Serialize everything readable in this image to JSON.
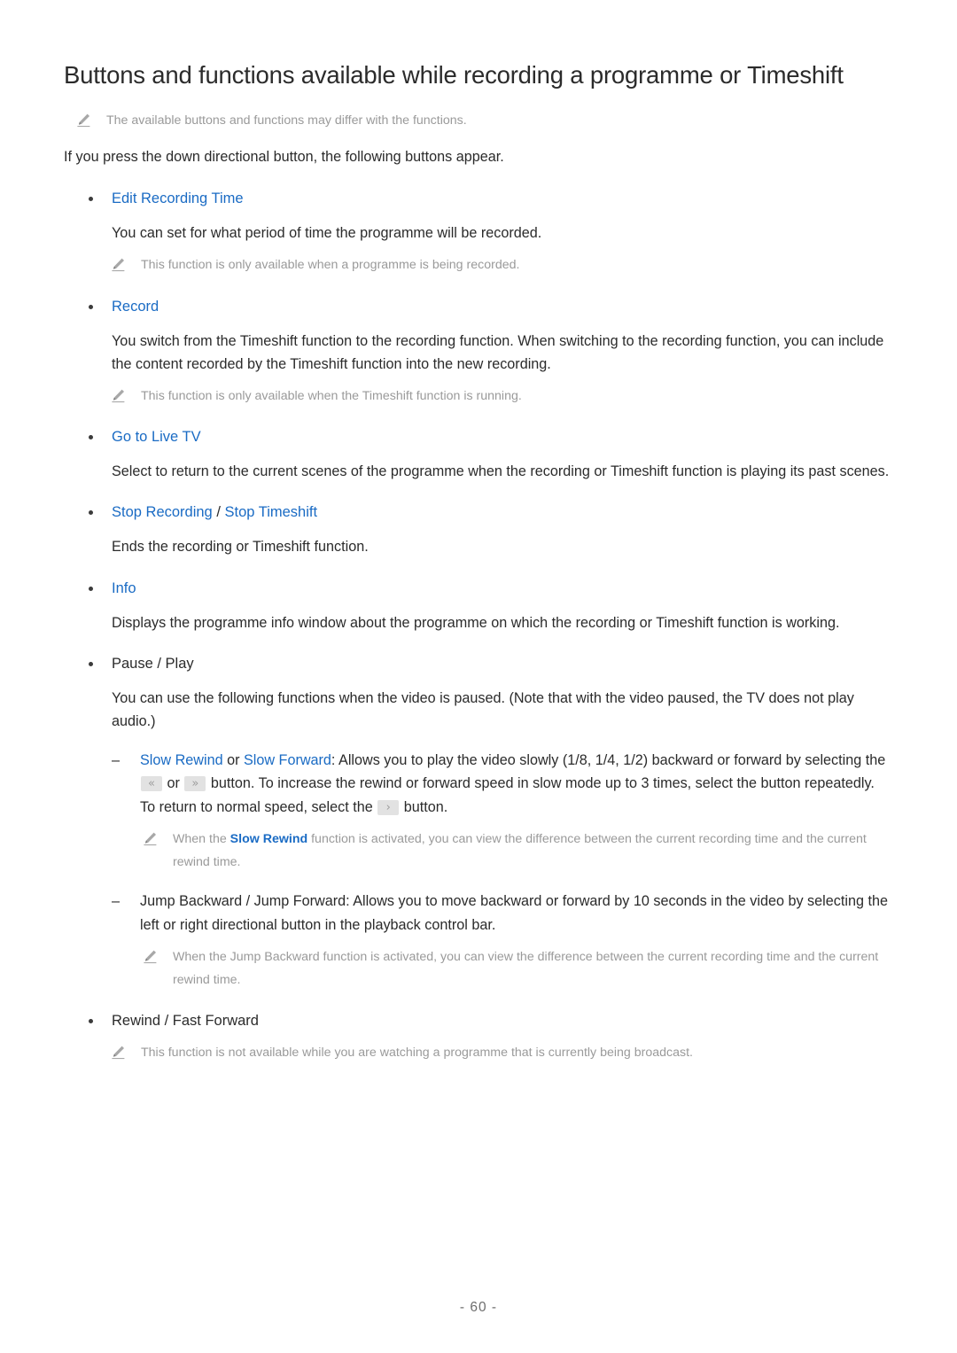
{
  "document": {
    "title": "Buttons and functions available while recording a programme or Timeshift",
    "page_number": "- 60 -",
    "accent_color": "#1a6bc4",
    "note_color": "#9a9a9a",
    "body_color": "#2b2b2b"
  },
  "top_note": {
    "icon": "pencil-icon",
    "text": "The available buttons and functions may differ with the functions."
  },
  "intro": "If you press the down directional button, the following buttons appear.",
  "sections": [
    {
      "heading": {
        "parts": [
          {
            "text": "Edit Recording Time",
            "style": "blue"
          }
        ]
      },
      "body": "You can set for what period of time the programme will be recorded.",
      "note": "This function is only available when a programme is being recorded."
    },
    {
      "heading": {
        "parts": [
          {
            "text": "Record",
            "style": "blue"
          }
        ]
      },
      "body": "You switch from the Timeshift function to the recording function. When switching to the recording function, you can include the content recorded by the Timeshift function into the new recording.",
      "note": "This function is only available when the Timeshift function is running."
    },
    {
      "heading": {
        "parts": [
          {
            "text": "Go to Live TV",
            "style": "blue"
          }
        ]
      },
      "body": "Select to return to the current scenes of the programme when the recording or Timeshift function is playing its past scenes.",
      "note": null
    },
    {
      "heading": {
        "parts": [
          {
            "text": "Stop Recording",
            "style": "blue"
          },
          {
            "text": " / ",
            "style": "dark"
          },
          {
            "text": "Stop Timeshift",
            "style": "blue"
          }
        ]
      },
      "body": "Ends the recording or Timeshift function.",
      "note": null
    },
    {
      "heading": {
        "parts": [
          {
            "text": "Info",
            "style": "blue"
          }
        ]
      },
      "body": "Displays the programme info window about the programme on which the recording or Timeshift function is working.",
      "note": null
    },
    {
      "heading": {
        "parts": [
          {
            "text": "Pause / Play",
            "style": "dark"
          }
        ]
      },
      "body": "You can use the following functions when the video is paused. (Note that with the video paused, the TV does not play audio.)",
      "note": null
    }
  ],
  "sub_items": [
    {
      "marker": "–",
      "label_blue_1": "Slow Rewind",
      "label_join": " or ",
      "label_blue_2": "Slow Forward",
      "text_a": ": Allows you to play the video slowly (1/8, 1/4, 1/2) backward or forward by selecting the ",
      "key_rewind": "«",
      "text_b": " or ",
      "key_forward": "»",
      "text_c": " button. To increase the rewind or forward speed in slow mode up to 3 times, select the button repeatedly. To return to normal speed, select the ",
      "key_play": "›",
      "text_d": " button.",
      "note_prefix": "When the ",
      "note_highlight": "Slow Rewind",
      "note_suffix": " function is activated, you can view the difference between the current recording time and the current rewind time."
    },
    {
      "marker": "–",
      "text": "Jump Backward / Jump Forward: Allows you to move backward or forward by 10 seconds in the video by selecting the left or right directional button in the playback control bar.",
      "note": "When the Jump Backward function is activated, you can view the difference between the current recording time and the current rewind time."
    }
  ],
  "final_section": {
    "heading": "Rewind / Fast Forward",
    "note": "This function is not available while you are watching a programme that is currently being broadcast."
  }
}
